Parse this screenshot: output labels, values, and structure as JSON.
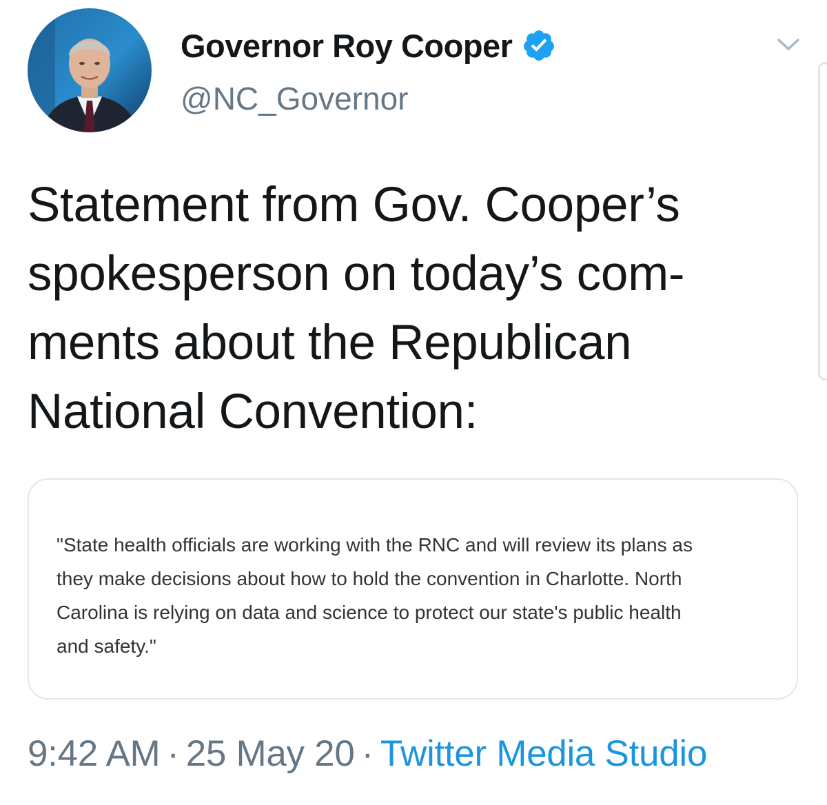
{
  "author": {
    "display_name": "Governor Roy Cooper",
    "handle": "@NC_Governor",
    "verified": true
  },
  "tweet": {
    "text_lines": [
      "Statement from Gov. Cooper’s",
      "spokesperson on today’s com-",
      "ments about the Republican",
      "National Convention:"
    ]
  },
  "statement_card": {
    "lines": [
      "\"State health officials are working with the RNC and will review its plans as",
      "they make decisions about how to hold the convention in Charlotte. North",
      "Carolina is relying on data and science to protect our state's public health",
      "and safety.\""
    ]
  },
  "meta": {
    "time": "9:42 AM",
    "separator": "·",
    "date": "25 May 20",
    "source": "Twitter Media Studio"
  },
  "icons": {
    "verified": "verified-badge-icon",
    "menu": "chevron-down-icon"
  },
  "colors": {
    "text": "#14171a",
    "secondary_text": "#657786",
    "link": "#1b95e0",
    "verified": "#1da1f2",
    "card_border": "#e3e6ea"
  }
}
